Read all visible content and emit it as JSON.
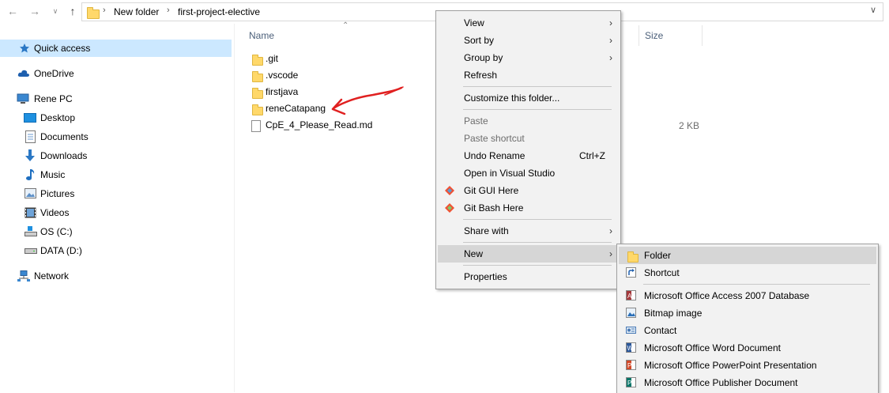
{
  "address_bar": {
    "breadcrumbs": [
      "New folder",
      "first-project-elective"
    ]
  },
  "nav_pane": {
    "items": [
      {
        "label": "Quick access",
        "icon": "star-icon"
      },
      {
        "label": "OneDrive",
        "icon": "cloud-icon"
      },
      {
        "label": "Rene PC",
        "icon": "computer-icon"
      },
      {
        "label": "Desktop",
        "icon": "desktop-icon"
      },
      {
        "label": "Documents",
        "icon": "documents-icon"
      },
      {
        "label": "Downloads",
        "icon": "download-icon"
      },
      {
        "label": "Music",
        "icon": "music-icon"
      },
      {
        "label": "Pictures",
        "icon": "pictures-icon"
      },
      {
        "label": "Videos",
        "icon": "videos-icon"
      },
      {
        "label": "OS (C:)",
        "icon": "drive-icon"
      },
      {
        "label": "DATA (D:)",
        "icon": "drive-icon"
      },
      {
        "label": "Network",
        "icon": "network-icon"
      }
    ]
  },
  "file_list": {
    "columns": {
      "name": "Name",
      "size": "Size"
    },
    "files": [
      {
        "name": ".git",
        "type": "folder",
        "size": ""
      },
      {
        "name": ".vscode",
        "type": "folder",
        "size": ""
      },
      {
        "name": "firstjava",
        "type": "folder",
        "size": ""
      },
      {
        "name": "reneCatapang",
        "type": "folder",
        "size": ""
      },
      {
        "name": "CpE_4_Please_Read.md",
        "type": "file",
        "size": "2 KB"
      }
    ]
  },
  "context_menu": {
    "items": [
      {
        "label": "View"
      },
      {
        "label": "Sort by"
      },
      {
        "label": "Group by"
      },
      {
        "label": "Refresh"
      },
      {
        "label": "Customize this folder..."
      },
      {
        "label": "Paste"
      },
      {
        "label": "Paste shortcut"
      },
      {
        "label": "Undo Rename",
        "accel": "Ctrl+Z"
      },
      {
        "label": "Open in Visual Studio"
      },
      {
        "label": "Git GUI Here"
      },
      {
        "label": "Git Bash Here"
      },
      {
        "label": "Share with"
      },
      {
        "label": "New"
      },
      {
        "label": "Properties"
      }
    ]
  },
  "new_submenu": {
    "items": [
      {
        "label": "Folder"
      },
      {
        "label": "Shortcut"
      },
      {
        "label": "Microsoft Office Access 2007 Database"
      },
      {
        "label": "Bitmap image"
      },
      {
        "label": "Contact"
      },
      {
        "label": "Microsoft Office Word Document"
      },
      {
        "label": "Microsoft Office PowerPoint Presentation"
      },
      {
        "label": "Microsoft Office Publisher Document"
      }
    ]
  },
  "colors": {
    "selection": "#cce8ff",
    "menu_bg": "#f2f2f2",
    "menu_highlight": "#d6d6d6",
    "annotation_arrow": "#e02020"
  }
}
